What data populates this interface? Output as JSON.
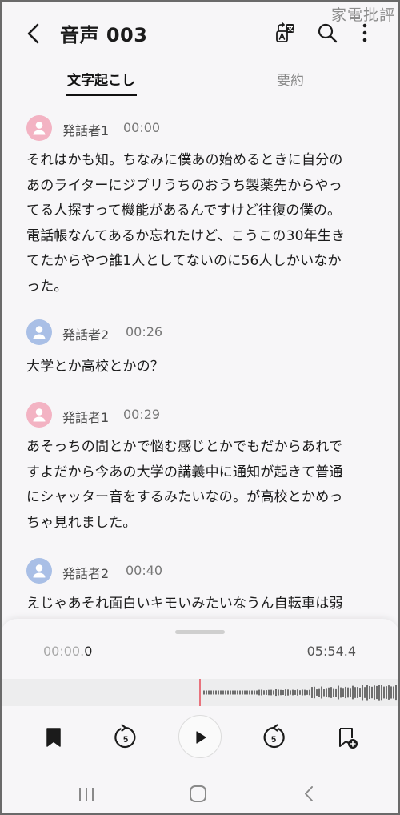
{
  "watermark": "家電批評",
  "header": {
    "title": "音声 003",
    "icons": [
      "back-icon",
      "translate-icon",
      "search-icon",
      "more-vertical-icon"
    ]
  },
  "tabs": [
    {
      "label": "文字起こし",
      "active": true
    },
    {
      "label": "要約",
      "active": false
    }
  ],
  "transcript": [
    {
      "speaker": "発話者1",
      "time": "00:00",
      "avatar_color": "#f3b3c3",
      "lines": [
        "それはかも知。ちなみに僕あの始めるときに自分の",
        "あのライターにジブリうちのおうち製薬先からやっ",
        "てる人探すって機能があるんですけど往復の僕の。",
        "電話帳なんてあるか忘れたけど、こうこの30年生き",
        "てたからやつ誰1人としてないのに56人しかいなか",
        "った。"
      ]
    },
    {
      "speaker": "発話者2",
      "time": "00:26",
      "avatar_color": "#a9bfe6",
      "lines": [
        "大学とか高校とかの？"
      ]
    },
    {
      "speaker": "発話者1",
      "time": "00:29",
      "avatar_color": "#f3b3c3",
      "lines": [
        "あそっちの間とかで悩む感じとかでもだからあれで",
        "すよだから今あの大学の講義中に通知が起きて普通",
        "にシャッター音をするみたいなの。が高校とかめっ",
        "ちゃ見れました。"
      ]
    },
    {
      "speaker": "発話者2",
      "time": "00:40",
      "avatar_color": "#a9bfe6",
      "lines": [
        "えじゃあそれ面白いキモいみたいなうん自転車は弱"
      ]
    }
  ],
  "player": {
    "current_time_dim": "00:00.",
    "current_time_bold": "0",
    "total_time": "05:54.4",
    "progress": 0,
    "accent_color": "#e8737d",
    "controls": [
      "bookmark-icon",
      "rewind-5-icon",
      "play-icon",
      "forward-5-icon",
      "add-bookmark-icon"
    ],
    "rewind_label": "5",
    "forward_label": "5"
  },
  "navbar": [
    "recent-apps-icon",
    "home-icon",
    "back-nav-icon"
  ]
}
